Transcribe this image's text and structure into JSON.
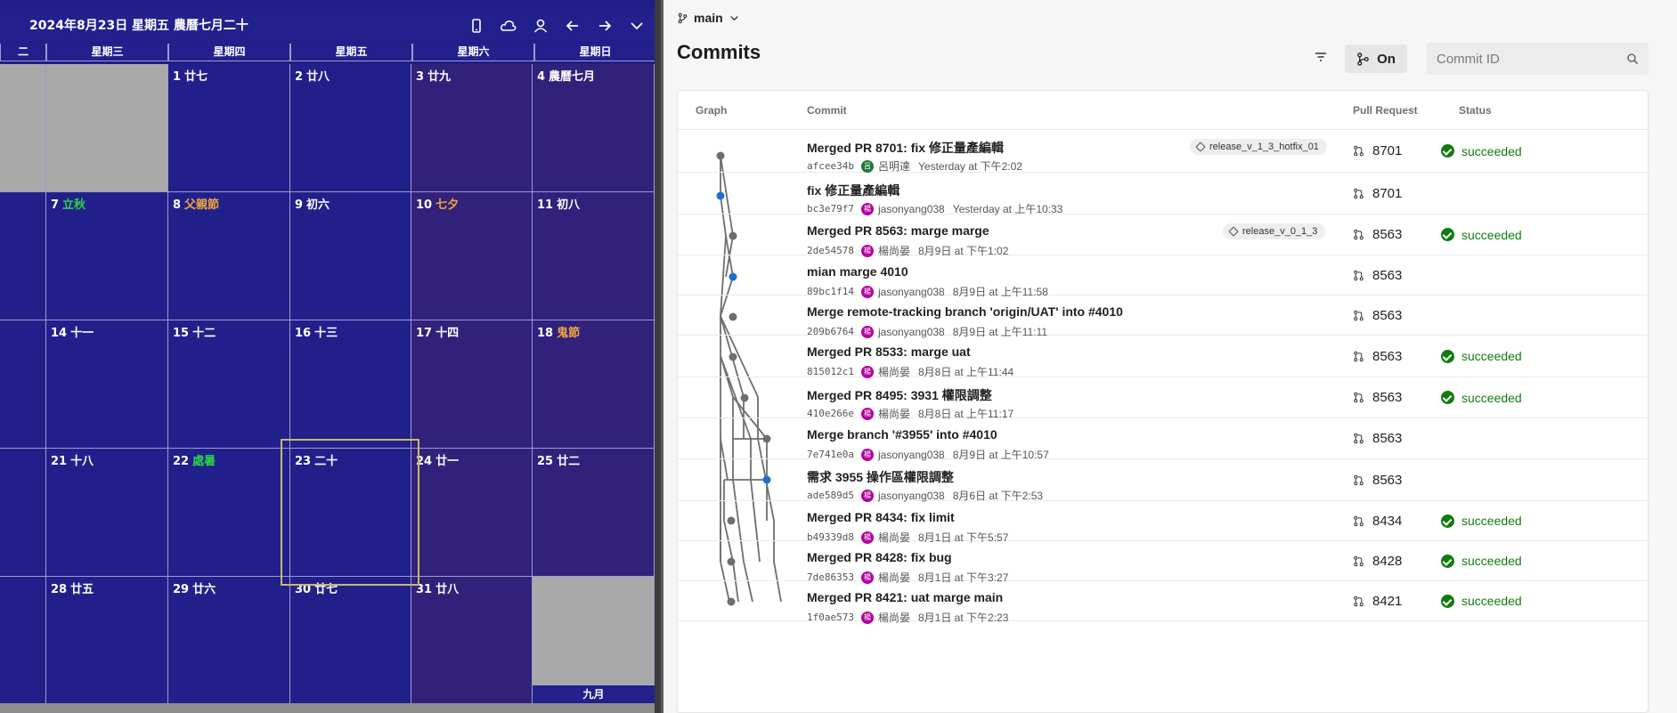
{
  "calendar": {
    "title": "2024年8月23日 星期五 農曆七月二十",
    "weekdays": [
      "二",
      "星期三",
      "星期四",
      "星期五",
      "星期六",
      "星期日"
    ],
    "next_month_label": "九月",
    "weeks": [
      [
        {
          "day": "",
          "lunar": "",
          "color": ""
        },
        {
          "day": "",
          "lunar": "",
          "color": ""
        },
        {
          "day": "1",
          "lunar": "廿七",
          "color": ""
        },
        {
          "day": "2",
          "lunar": "廿八",
          "color": ""
        },
        {
          "day": "3",
          "lunar": "廿九",
          "color": ""
        },
        {
          "day": "4",
          "lunar": "農曆七月",
          "color": ""
        }
      ],
      [
        {
          "day": "",
          "lunar": "",
          "color": ""
        },
        {
          "day": "7",
          "lunar": "立秋",
          "color": "green"
        },
        {
          "day": "8",
          "lunar": "父親節",
          "color": "orange"
        },
        {
          "day": "9",
          "lunar": "初六",
          "color": ""
        },
        {
          "day": "10",
          "lunar": "七夕",
          "color": "orange"
        },
        {
          "day": "11",
          "lunar": "初八",
          "color": ""
        }
      ],
      [
        {
          "day": "",
          "lunar": "",
          "color": ""
        },
        {
          "day": "14",
          "lunar": "十一",
          "color": ""
        },
        {
          "day": "15",
          "lunar": "十二",
          "color": ""
        },
        {
          "day": "16",
          "lunar": "十三",
          "color": ""
        },
        {
          "day": "17",
          "lunar": "十四",
          "color": ""
        },
        {
          "day": "18",
          "lunar": "鬼節",
          "color": "orange"
        }
      ],
      [
        {
          "day": "",
          "lunar": "",
          "color": ""
        },
        {
          "day": "21",
          "lunar": "十八",
          "color": ""
        },
        {
          "day": "22",
          "lunar": "處暑",
          "color": "green"
        },
        {
          "day": "23",
          "lunar": "二十",
          "color": ""
        },
        {
          "day": "24",
          "lunar": "廿一",
          "color": ""
        },
        {
          "day": "25",
          "lunar": "廿二",
          "color": ""
        }
      ],
      [
        {
          "day": "",
          "lunar": "",
          "color": ""
        },
        {
          "day": "28",
          "lunar": "廿五",
          "color": ""
        },
        {
          "day": "29",
          "lunar": "廿六",
          "color": ""
        },
        {
          "day": "30",
          "lunar": "廿七",
          "color": ""
        },
        {
          "day": "31",
          "lunar": "廿八",
          "color": ""
        },
        {
          "day": "",
          "lunar": "",
          "color": ""
        }
      ]
    ],
    "icons": [
      "phone-icon",
      "cloud-icon",
      "person-icon",
      "arrow-left-icon",
      "arrow-right-icon",
      "chevron-down-icon"
    ],
    "colors": {
      "background": "#21208a",
      "weekend": "#31217a",
      "holiday_green": "#2ad34a",
      "holiday_orange": "#f0a53b"
    }
  },
  "repo": {
    "branch": "main",
    "title": "Commits",
    "graph_toggle_label": "On",
    "search_placeholder": "Commit ID",
    "columns": {
      "graph": "Graph",
      "commit": "Commit",
      "pull_request": "Pull Request",
      "status": "Status"
    },
    "commits": [
      {
        "message": "Merged PR 8701: fix 修正量產編輯",
        "sha": "afcee34b",
        "author": "呂明達",
        "avatar": "呂",
        "avatar_color": "#1e7a3a",
        "time": "Yesterday at 下午2:02",
        "tag": "release_v_1_3_hotfix_01",
        "pr": "8701",
        "status": "succeeded"
      },
      {
        "message": "fix 修正量產編輯",
        "sha": "bc3e79f7",
        "author": "jasonyang038",
        "avatar": "楊",
        "avatar_color": "#b4009e",
        "time": "Yesterday at 上午10:33",
        "tag": "",
        "pr": "8701",
        "status": ""
      },
      {
        "message": "Merged PR 8563: marge marge",
        "sha": "2de54578",
        "author": "楊尚晏",
        "avatar": "楊",
        "avatar_color": "#b4009e",
        "time": "8月9日 at 下午1:02",
        "tag": "release_v_0_1_3",
        "pr": "8563",
        "status": "succeeded"
      },
      {
        "message": "mian marge 4010",
        "sha": "89bc1f14",
        "author": "jasonyang038",
        "avatar": "楊",
        "avatar_color": "#b4009e",
        "time": "8月9日 at 上午11:58",
        "tag": "",
        "pr": "8563",
        "status": ""
      },
      {
        "message": "Merge remote-tracking branch 'origin/UAT' into #4010",
        "sha": "209b6764",
        "author": "jasonyang038",
        "avatar": "楊",
        "avatar_color": "#b4009e",
        "time": "8月9日 at 上午11:11",
        "tag": "",
        "pr": "8563",
        "status": ""
      },
      {
        "message": "Merged PR 8533: marge uat",
        "sha": "815012c1",
        "author": "楊尚晏",
        "avatar": "楊",
        "avatar_color": "#b4009e",
        "time": "8月8日 at 上午11:44",
        "tag": "",
        "pr": "8563",
        "status": "succeeded"
      },
      {
        "message": "Merged PR 8495: 3931 權限調整",
        "sha": "410e266e",
        "author": "楊尚晏",
        "avatar": "楊",
        "avatar_color": "#b4009e",
        "time": "8月8日 at 上午11:17",
        "tag": "",
        "pr": "8563",
        "status": "succeeded"
      },
      {
        "message": "Merge branch '#3955' into #4010",
        "sha": "7e741e0a",
        "author": "jasonyang038",
        "avatar": "楊",
        "avatar_color": "#b4009e",
        "time": "8月9日 at 上午10:57",
        "tag": "",
        "pr": "8563",
        "status": ""
      },
      {
        "message": "需求 3955 操作區權限調整",
        "sha": "ade589d5",
        "author": "jasonyang038",
        "avatar": "楊",
        "avatar_color": "#b4009e",
        "time": "8月6日 at 下午2:53",
        "tag": "",
        "pr": "8563",
        "status": ""
      },
      {
        "message": "Merged PR 8434: fix limit",
        "sha": "b49339d8",
        "author": "楊尚晏",
        "avatar": "楊",
        "avatar_color": "#b4009e",
        "time": "8月1日 at 下午5:57",
        "tag": "",
        "pr": "8434",
        "status": "succeeded"
      },
      {
        "message": "Merged PR 8428: fix bug",
        "sha": "7de86353",
        "author": "楊尚晏",
        "avatar": "楊",
        "avatar_color": "#b4009e",
        "time": "8月1日 at 下午3:27",
        "tag": "",
        "pr": "8428",
        "status": "succeeded"
      },
      {
        "message": "Merged PR 8421: uat marge main",
        "sha": "1f0ae573",
        "author": "楊尚晏",
        "avatar": "楊",
        "avatar_color": "#b4009e",
        "time": "8月1日 at 下午2:23",
        "tag": "",
        "pr": "8421",
        "status": "succeeded"
      }
    ],
    "colors": {
      "success": "#107c10",
      "graph_line": "#6e6e6e",
      "graph_highlight": "#1c6fd1"
    }
  }
}
